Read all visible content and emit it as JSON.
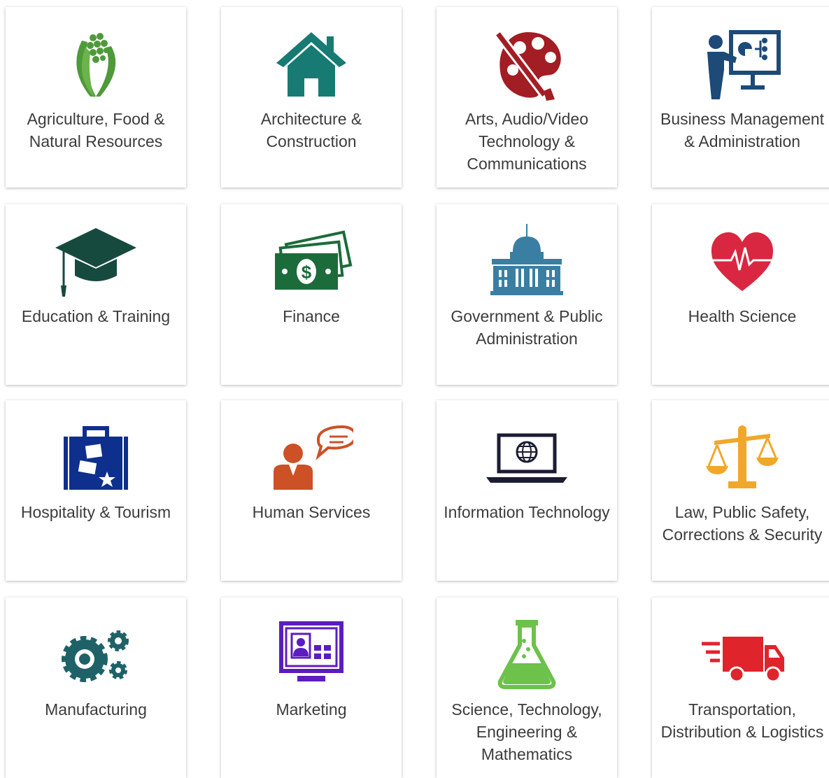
{
  "cards": [
    {
      "label": "Agriculture, Food & Natural Resources",
      "icon": "corn-icon",
      "color": "#4e9a3a"
    },
    {
      "label": "Architecture & Construction",
      "icon": "house-icon",
      "color": "#177b74"
    },
    {
      "label": "Arts, Audio/Video Technology & Communications",
      "icon": "palette-icon",
      "color": "#a31d24"
    },
    {
      "label": "Business Management & Administration",
      "icon": "presentation-icon",
      "color": "#1d4a77"
    },
    {
      "label": "Education & Training",
      "icon": "graduation-cap-icon",
      "color": "#174a3e"
    },
    {
      "label": "Finance",
      "icon": "money-icon",
      "color": "#1c6b3a"
    },
    {
      "label": "Government & Public Administration",
      "icon": "capitol-building-icon",
      "color": "#3a7fa3"
    },
    {
      "label": "Health Science",
      "icon": "heart-pulse-icon",
      "color": "#d92741"
    },
    {
      "label": "Hospitality & Tourism",
      "icon": "suitcase-icon",
      "color": "#0f2f8c"
    },
    {
      "label": "Human Services",
      "icon": "person-speech-icon",
      "color": "#cc5127"
    },
    {
      "label": "Information Technology",
      "icon": "laptop-globe-icon",
      "color": "#1b1d33"
    },
    {
      "label": "Law, Public Safety, Corrections & Security",
      "icon": "scales-icon",
      "color": "#f0a82a"
    },
    {
      "label": "Manufacturing",
      "icon": "gears-icon",
      "color": "#1e6268"
    },
    {
      "label": "Marketing",
      "icon": "monitor-icon",
      "color": "#5b1dbf"
    },
    {
      "label": "Science, Technology, Engineering & Mathematics",
      "icon": "flask-icon",
      "color": "#6cc24a"
    },
    {
      "label": "Transportation, Distribution & Logistics",
      "icon": "truck-icon",
      "color": "#e0242b"
    }
  ]
}
